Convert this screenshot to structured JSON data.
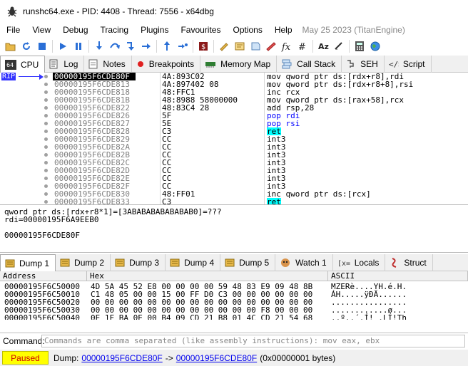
{
  "title": "runshc64.exe - PID: 4408 - Thread: 7556 - x64dbg",
  "menu": [
    "File",
    "View",
    "Debug",
    "Tracing",
    "Plugins",
    "Favourites",
    "Options",
    "Help"
  ],
  "menu_date": "May 25 2023 (TitanEngine)",
  "toolbar_icons": [
    "open-icon",
    "restart-icon",
    "stop-icon",
    "run-icon",
    "pause-icon",
    "step-into-icon",
    "step-over-icon",
    "trace-into-icon",
    "trace-over-icon",
    "execute-till-return-icon",
    "execute-till-user-icon",
    "script-icon",
    "comment-icon",
    "label-icon",
    "bookmark-icon",
    "function-icon",
    "fx-icon",
    "hash-icon",
    "font-icon",
    "reset-icon",
    "calculator-icon",
    "globe-icon"
  ],
  "tabs": [
    {
      "label": "CPU",
      "icon": "cpu-icon",
      "active": true
    },
    {
      "label": "Log",
      "icon": "log-icon"
    },
    {
      "label": "Notes",
      "icon": "notes-icon"
    },
    {
      "label": "Breakpoints",
      "icon": "breakpoint-icon"
    },
    {
      "label": "Memory Map",
      "icon": "memory-icon"
    },
    {
      "label": "Call Stack",
      "icon": "callstack-icon"
    },
    {
      "label": "SEH",
      "icon": "seh-icon"
    },
    {
      "label": "Script",
      "icon": "script-icon"
    }
  ],
  "rip_label": "RIP",
  "disasm": [
    {
      "addr": "00000195F6CDE80F",
      "bytes": "4A:893C02",
      "instr": "mov qword ptr ds:[rdx+r8],rdi",
      "current": true
    },
    {
      "addr": "00000195F6CDE813",
      "bytes": "4A:897402 08",
      "instr": "mov qword ptr ds:[rdx+r8+8],rsi"
    },
    {
      "addr": "00000195F6CDE818",
      "bytes": "48:FFC1",
      "instr": "inc rcx"
    },
    {
      "addr": "00000195F6CDE81B",
      "bytes": "48:8988 58000000",
      "instr": "mov qword ptr ds:[rax+58],rcx"
    },
    {
      "addr": "00000195F6CDE822",
      "bytes": "48:83C4 28",
      "instr": "add rsp,28"
    },
    {
      "addr": "00000195F6CDE826",
      "bytes": "5F",
      "instr": "pop rdi",
      "kind": "pop"
    },
    {
      "addr": "00000195F6CDE827",
      "bytes": "5E",
      "instr": "pop rsi",
      "kind": "pop"
    },
    {
      "addr": "00000195F6CDE828",
      "bytes": "C3",
      "instr": "ret",
      "kind": "ret"
    },
    {
      "addr": "00000195F6CDE829",
      "bytes": "CC",
      "instr": "int3"
    },
    {
      "addr": "00000195F6CDE82A",
      "bytes": "CC",
      "instr": "int3"
    },
    {
      "addr": "00000195F6CDE82B",
      "bytes": "CC",
      "instr": "int3"
    },
    {
      "addr": "00000195F6CDE82C",
      "bytes": "CC",
      "instr": "int3"
    },
    {
      "addr": "00000195F6CDE82D",
      "bytes": "CC",
      "instr": "int3"
    },
    {
      "addr": "00000195F6CDE82E",
      "bytes": "CC",
      "instr": "int3"
    },
    {
      "addr": "00000195F6CDE82F",
      "bytes": "CC",
      "instr": "int3"
    },
    {
      "addr": "00000195F6CDE830",
      "bytes": "48:FF01",
      "instr": "inc qword ptr ds:[rcx]"
    },
    {
      "addr": "00000195F6CDE833",
      "bytes": "C3",
      "instr": "ret",
      "kind": "ret"
    }
  ],
  "info_lines": [
    "qword ptr ds:[rdx+r8*1]=[3ABABABABABABAB0]=???",
    "rdi=00000195F6A9EEB0",
    "",
    "00000195F6CDE80F"
  ],
  "dump_tabs": [
    {
      "label": "Dump 1",
      "active": true
    },
    {
      "label": "Dump 2"
    },
    {
      "label": "Dump 3"
    },
    {
      "label": "Dump 4"
    },
    {
      "label": "Dump 5"
    },
    {
      "label": "Watch 1"
    },
    {
      "label": "Locals"
    },
    {
      "label": "Struct"
    }
  ],
  "dump_headers": {
    "address": "Address",
    "hex": "Hex",
    "ascii": "ASCII"
  },
  "dump_rows": [
    {
      "addr": "00000195F6C50000",
      "hex": "4D 5A 45 52 E8 00 00 00 00 59 48 83 E9 09 48 8B",
      "ascii": "MZERè....YH.é.H."
    },
    {
      "addr": "00000195F6C50010",
      "hex": "C1 48 05 00 00 15 00 FF D0 C3 00 00 00 00 00 00",
      "ascii": "ÁH.....ÿÐÃ......"
    },
    {
      "addr": "00000195F6C50020",
      "hex": "00 00 00 00 00 00 00 00 00 00 00 00 00 00 00 00",
      "ascii": "................"
    },
    {
      "addr": "00000195F6C50030",
      "hex": "00 00 00 00 00 00 00 00 00 00 00 00 F8 00 00 00",
      "ascii": "............ø..."
    },
    {
      "addr": "00000195F6C50040",
      "hex": "0E 1F BA 0E 00 B4 09 CD 21 B8 01 4C CD 21 54 68",
      "ascii": "..º..´.Í!¸.LÍ!Th"
    }
  ],
  "command_label": "Command:",
  "command_placeholder": "Commands are comma separated (like assembly instructions): mov eax, ebx",
  "status": {
    "state": "Paused",
    "dump_prefix": "Dump:",
    "from": "00000195F6CDE80F",
    "arrow": "->",
    "to": "00000195F6CDE80F",
    "size": "(0x00000001 bytes)"
  },
  "colors": {
    "paused_bg": "#ffff00",
    "paused_fg": "#cc0000",
    "ret_highlight": "#00ffff",
    "rip": "#3333ff"
  }
}
